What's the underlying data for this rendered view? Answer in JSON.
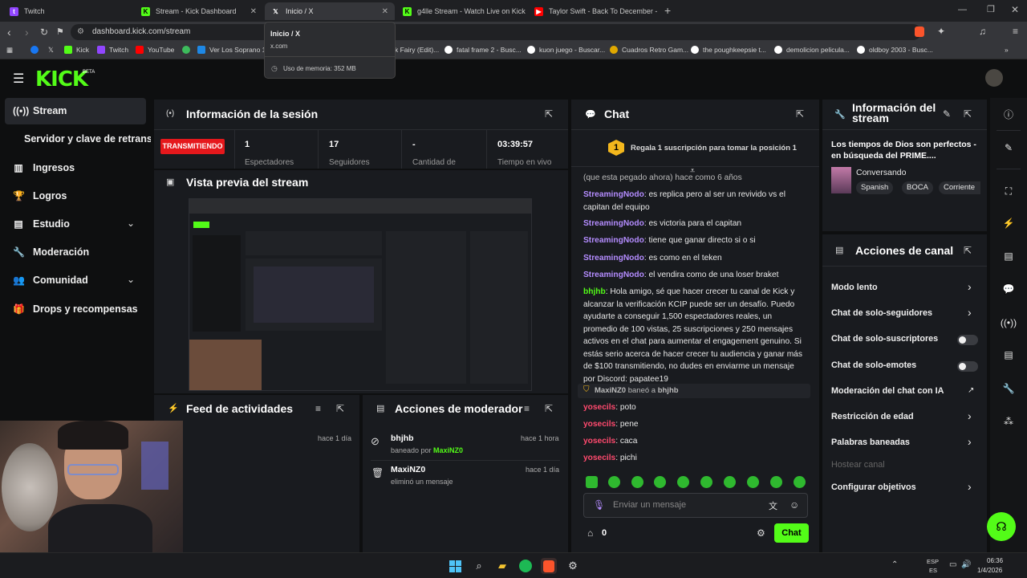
{
  "browser": {
    "tabs": [
      {
        "label": "Twitch"
      },
      {
        "label": "Stream - Kick Dashboard"
      },
      {
        "label": "Inicio / X"
      },
      {
        "label": "g4lle Stream - Watch Live on Kick"
      },
      {
        "label": "Taylor Swift - Back To December - Yo"
      }
    ],
    "url": "dashboard.kick.com/stream",
    "bookmarks": [
      "Kick",
      "Twitch",
      "YouTube",
      "Ver Los Soprano 1x",
      "k Fairy (Edit)...",
      "fatal frame 2 - Busc...",
      "kuon juego - Buscar...",
      "Cuadros Retro Gam...",
      "the poughkeepsie t...",
      "demolicion pelicula...",
      "oldboy 2003 - Busc..."
    ],
    "tooltip": {
      "title": "Inicio / X",
      "domain": "x.com",
      "memory": "Uso de memoria: 352 MB"
    }
  },
  "kick": {
    "logo": "KICK",
    "logo_badge": "BETA"
  },
  "sidebar": {
    "items": [
      {
        "label": "Stream",
        "icon": "broadcast-icon"
      },
      {
        "label": "Servidor y clave de retransmisión"
      },
      {
        "label": "Ingresos",
        "icon": "chart-icon"
      },
      {
        "label": "Logros",
        "icon": "trophy-icon"
      },
      {
        "label": "Estudio",
        "icon": "grid-icon"
      },
      {
        "label": "Moderación",
        "icon": "wrench-icon"
      },
      {
        "label": "Comunidad",
        "icon": "people-icon"
      },
      {
        "label": "Drops y recompensas",
        "icon": "gift-icon"
      }
    ]
  },
  "session": {
    "title": "Información de la sesión",
    "live_badge": "TRANSMITIENDO",
    "stats": [
      {
        "value": "1",
        "label": "Espectadores"
      },
      {
        "value": "17",
        "label": "Seguidores"
      },
      {
        "value": "-",
        "label": "Cantidad de"
      },
      {
        "value": "03:39:57",
        "label": "Tiempo en vivo"
      }
    ],
    "live_label_trunc": "En vivo"
  },
  "preview": {
    "title": "Vista previa del stream"
  },
  "feed": {
    "title": "Feed de actividades",
    "time": "hace 1 día"
  },
  "modactions": {
    "title": "Acciones de moderador",
    "items": [
      {
        "user": "bhjhb",
        "desc_prefix": "baneado por ",
        "by": "MaxiNZ0",
        "time": "hace 1 hora"
      },
      {
        "user": "MaxiNZ0",
        "desc": "eliminó un mensaje",
        "time": "hace 1 día"
      }
    ]
  },
  "chat": {
    "title": "Chat",
    "gift_text": "Regala 1 suscripción para tomar la posición 1",
    "gift_badge": "1",
    "partial_line": "(que esta pegado ahora) hace como 6 años",
    "messages": [
      {
        "user": "StreamingNodo",
        "text": ": es replica pero al ser un revivido vs el capitan del equipo"
      },
      {
        "user": "StreamingNodo",
        "text": ": es victoria para el capitan"
      },
      {
        "user": "StreamingNodo",
        "text": ": tiene que ganar directo si o si"
      },
      {
        "user": "StreamingNodo",
        "text": ": es como en el teken"
      },
      {
        "user": "StreamingNodo",
        "text": ": el vendira como de una loser braket"
      },
      {
        "user": "bhjhb",
        "text": ": Hola amigo, sé que hacer crecer tu canal de Kick y alcanzar la verificación KCIP puede ser un desafío. Puedo ayudarte a conseguir 1,500 espectadores reales, un promedio de 100 vistas, 25 suscripciones y 250 mensajes activos en el chat para aumentar el engagement genuino. Si estás serio acerca de hacer crecer tu audiencia y ganar más de $100 transmitiendo, no dudes en enviarme un mensaje por Discord: papatee19"
      }
    ],
    "ban_notice": {
      "mod": "MaxiNZ0",
      "verb": " baneó a ",
      "user": "bhjhb"
    },
    "short_messages": [
      {
        "user": "yosecils",
        "text": ": poto"
      },
      {
        "user": "yosecils",
        "text": ": pene"
      },
      {
        "user": "yosecils",
        "text": ": caca"
      },
      {
        "user": "yosecils",
        "text": ": pichi"
      }
    ],
    "input_placeholder": "Enviar un mensaje",
    "points": "0",
    "send_label": "Chat"
  },
  "stream_info": {
    "title": "Información del stream",
    "stream_title": "Los tiempos de Dios son perfectos - en búsqueda del PRIME....",
    "category": "Conversando",
    "tags": [
      "Spanish",
      "BOCA",
      "Corriente"
    ]
  },
  "channel_actions": {
    "title": "Acciones de canal",
    "items": [
      {
        "label": "Modo lento",
        "control": "chevron"
      },
      {
        "label": "Chat de solo-seguidores",
        "control": "chevron"
      },
      {
        "label": "Chat de solo-suscriptores",
        "control": "toggle"
      },
      {
        "label": "Chat de solo-emotes",
        "control": "toggle"
      },
      {
        "label": "Moderación del chat con IA",
        "control": "external"
      },
      {
        "label": "Restricción de edad",
        "control": "chevron"
      },
      {
        "label": "Palabras baneadas",
        "control": "chevron"
      },
      {
        "label": "Hostear canal",
        "control": "disabled"
      },
      {
        "label": "Configurar objetivos",
        "control": "chevron"
      }
    ]
  },
  "taskbar": {
    "lang_top": "ESP",
    "lang_bottom": "ES",
    "time": "06:36",
    "date": "1/4/2026"
  },
  "colors": {
    "kick_green": "#53fc18",
    "live_red": "#e5181c",
    "panel": "#191b1f",
    "background": "#0e0f10"
  }
}
